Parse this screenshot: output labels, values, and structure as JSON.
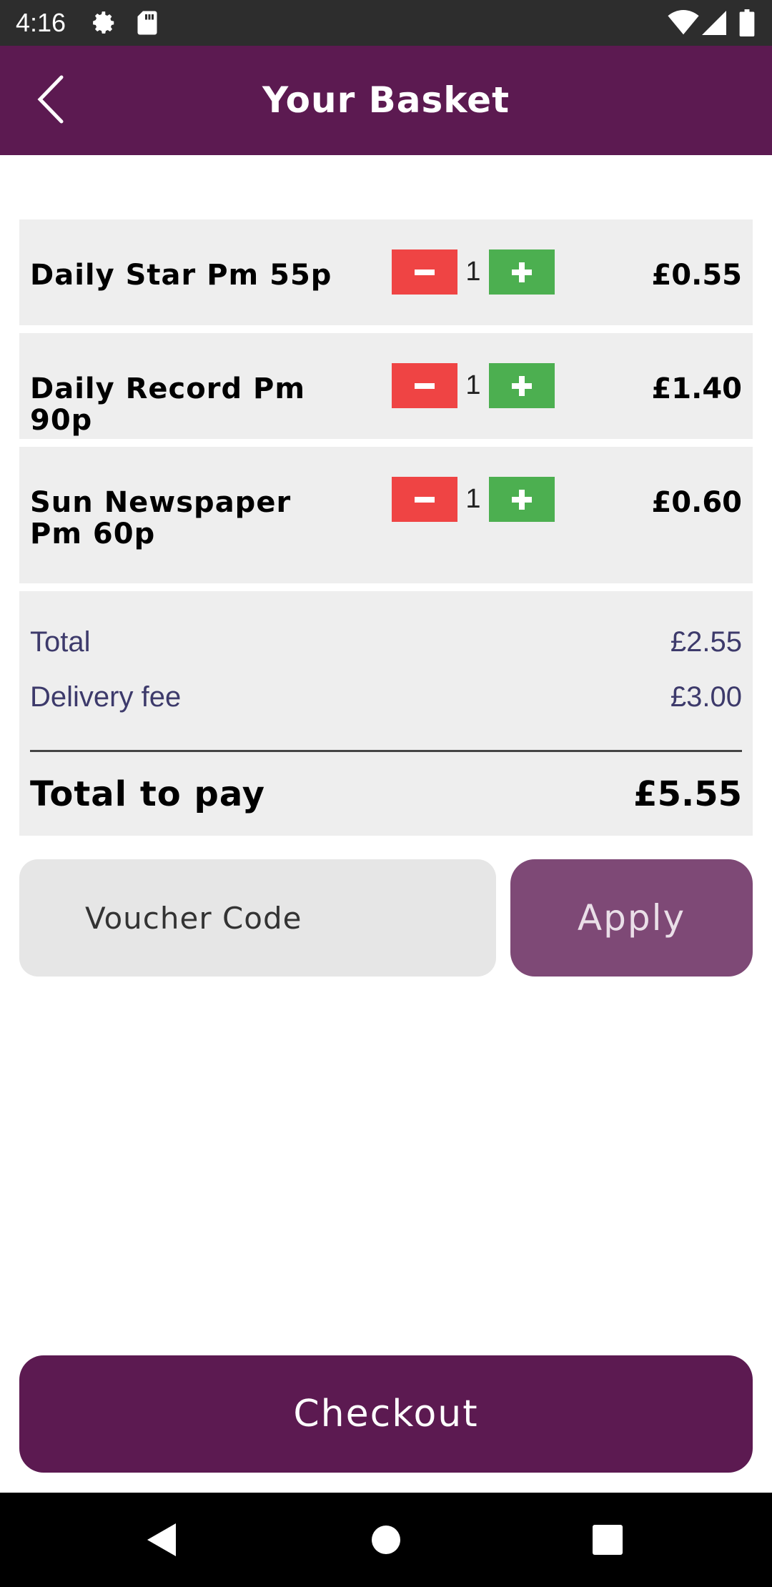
{
  "status_bar": {
    "time": "4:16",
    "icons": [
      "gear-icon",
      "sd-card-icon",
      "wifi-icon",
      "cell-signal-icon",
      "battery-icon"
    ]
  },
  "header": {
    "title": "Your Basket",
    "back_icon": "chevron-left-icon",
    "background": "#5c1a51"
  },
  "basket": {
    "items": [
      {
        "name": "Daily Star Pm 55p",
        "quantity": "1",
        "price": "£0.55"
      },
      {
        "name": "Daily Record Pm 90p",
        "quantity": "1",
        "price": "£1.40"
      },
      {
        "name": "Sun Newspaper Pm 60p",
        "quantity": "1",
        "price": "£0.60"
      }
    ],
    "minus_color": "#ef4444",
    "plus_color": "#4caf50"
  },
  "summary": {
    "total_label": "Total",
    "total_value": "£2.55",
    "delivery_label": "Delivery fee",
    "delivery_value": "£3.00",
    "grand_label": "Total to pay",
    "grand_value": "£5.55"
  },
  "voucher": {
    "placeholder": "Voucher Code",
    "value": "",
    "apply_label": "Apply"
  },
  "checkout": {
    "label": "Checkout"
  },
  "nav_bar": {
    "icons": [
      "back-triangle-icon",
      "home-circle-icon",
      "recents-square-icon"
    ]
  }
}
